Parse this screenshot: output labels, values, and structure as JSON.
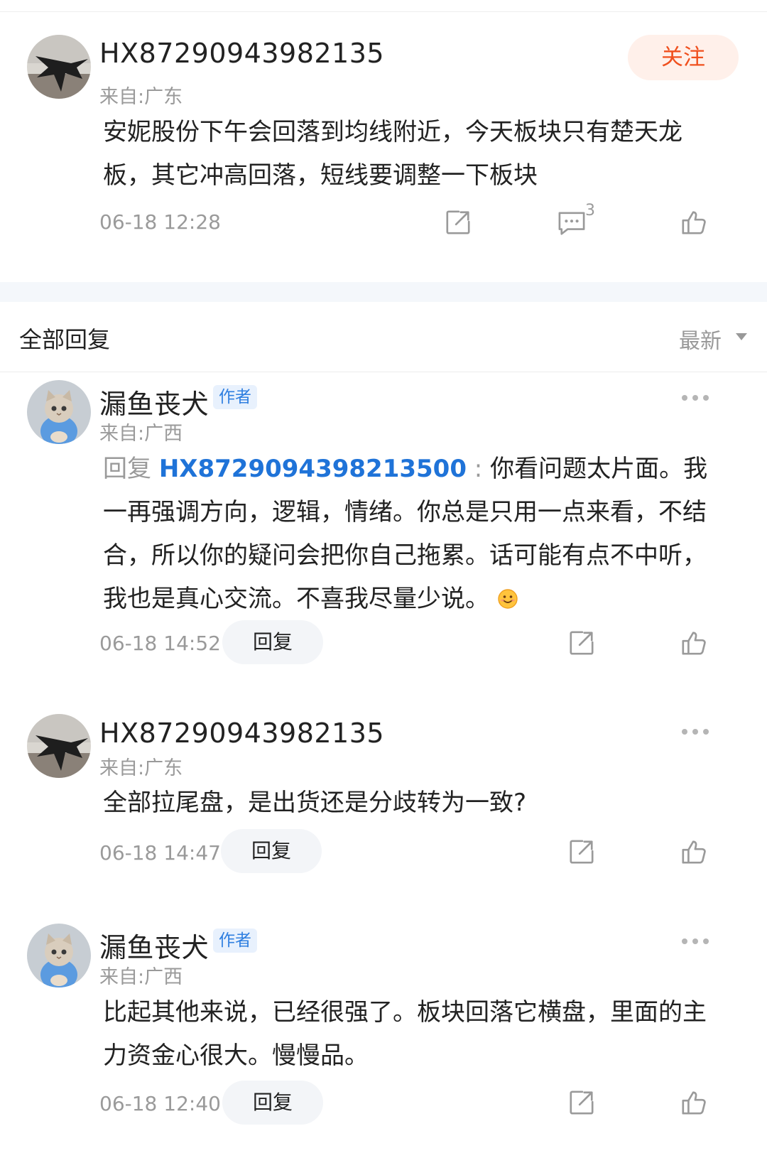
{
  "post": {
    "username": "HX87290943982135",
    "location": "来自:广东",
    "follow_label": "关注",
    "content": "安妮股份下午会回落到均线附近，今天板块只有楚天龙板，其它冲高回落，短线要调整一下板块",
    "timestamp": "06-18 12:28",
    "comment_count": "3"
  },
  "replies_section": {
    "title": "全部回复",
    "sort_label": "最新"
  },
  "replies": [
    {
      "username": "漏鱼丧犬",
      "badge": "作者",
      "location": "来自:广西",
      "reply_prefix": "回复",
      "mention": "HX8729094398213500",
      "separator": " : ",
      "content": "你看问题太片面。我一再强调方向，逻辑，情绪。你总是只用一点来看，不结合，所以你的疑问会把你自己拖累。话可能有点不中听，我也是真心交流。不喜我尽量少说。",
      "emoji": "smiling-face-icon",
      "timestamp": "06-18 14:52",
      "reply_label": "回复"
    },
    {
      "username": "HX87290943982135",
      "location": "来自:广东",
      "content": "全部拉尾盘，是出货还是分歧转为一致?",
      "timestamp": "06-18 14:47",
      "reply_label": "回复"
    },
    {
      "username": "漏鱼丧犬",
      "badge": "作者",
      "location": "来自:广西",
      "content": "比起其他来说，已经很强了。板块回落它横盘，里面的主力资金心很大。慢慢品。",
      "timestamp": "06-18 12:40",
      "reply_label": "回复"
    }
  ],
  "colors": {
    "accent_orange": "#f0501e",
    "follow_bg": "#fff0ea",
    "link_blue": "#1f73d8",
    "badge_bg": "#e8f1fd",
    "muted_gray": "#9a9a9a",
    "band_bg": "#f4f7fb"
  },
  "icons": {
    "share": "share-icon",
    "comment": "comment-icon",
    "like": "thumbs-up-icon",
    "more": "more-icon",
    "sort": "caret-down-icon"
  }
}
